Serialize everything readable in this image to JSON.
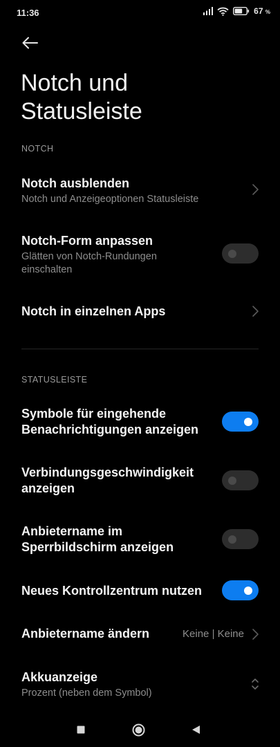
{
  "status_bar": {
    "time": "11:36",
    "battery_percent": "67",
    "battery_unit": "%",
    "battery_level": 0.67
  },
  "header": {
    "title": "Notch und Statusleiste"
  },
  "sections": {
    "notch": {
      "label": "NOTCH",
      "items": [
        {
          "title": "Notch ausblenden",
          "subtitle": "Notch und Anzeigeoptionen Statusleiste",
          "control": "chevron"
        },
        {
          "title": "Notch-Form anpassen",
          "subtitle": "Glätten von Notch-Rundungen einschalten",
          "control": "toggle",
          "on": false
        },
        {
          "title": "Notch in einzelnen Apps",
          "control": "chevron"
        }
      ]
    },
    "statusleiste": {
      "label": "STATUSLEISTE",
      "items": [
        {
          "title": "Symbole für eingehende Benachrichtigungen anzeigen",
          "control": "toggle",
          "on": true
        },
        {
          "title": "Verbindungsgeschwindigkeit anzeigen",
          "control": "toggle",
          "on": false
        },
        {
          "title": "Anbietername im Sperrbildschirm anzeigen",
          "control": "toggle",
          "on": false
        },
        {
          "title": "Neues Kontrollzentrum nutzen",
          "control": "toggle",
          "on": true
        },
        {
          "title": "Anbietername ändern",
          "value": "Keine | Keine",
          "control": "chevron"
        },
        {
          "title": "Akkuanzeige",
          "subtitle": "Prozent (neben dem Symbol)",
          "control": "dropdown"
        }
      ]
    }
  },
  "colors": {
    "background": "#000000",
    "accent": "#0d7df0",
    "toggle_off": "#2d2d2d",
    "subtitle": "#8d8d8d"
  }
}
